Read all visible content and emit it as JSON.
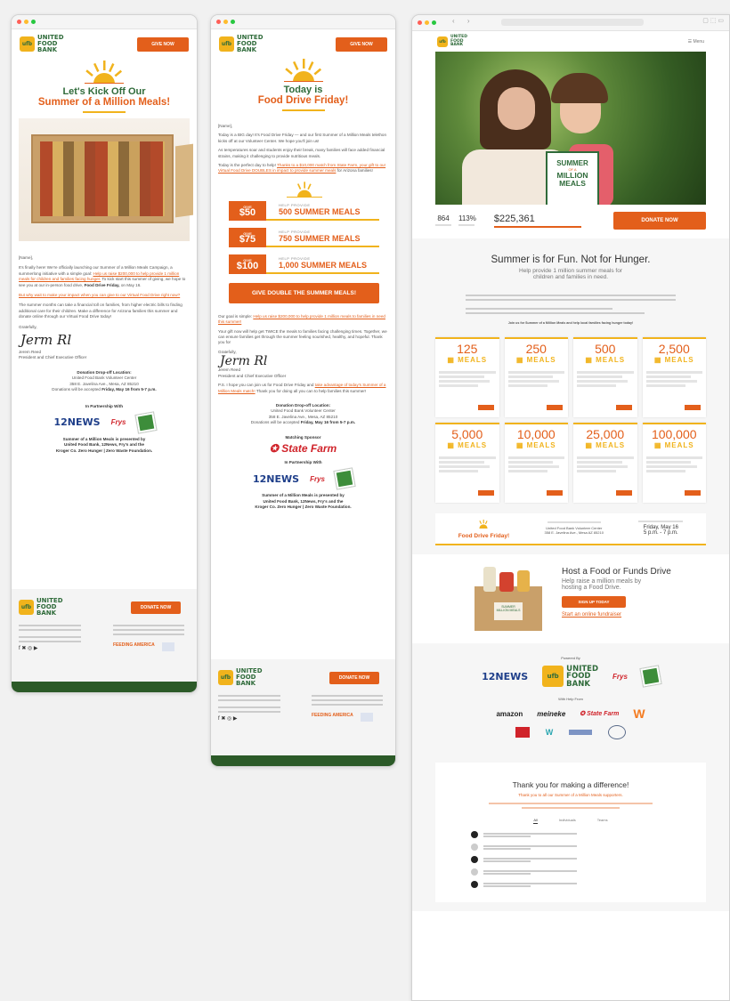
{
  "email1": {
    "logo": {
      "badge": "ufb",
      "line1": "UNITED",
      "line2": "FOOD",
      "line3": "BANK"
    },
    "give_now": "GIVE NOW",
    "headline1": "Let's Kick Off Our",
    "headline2": "Summer of a Million Meals!",
    "salutation": "[Name],",
    "para1": "It's finally here! We're officially launching our Summer of a Million Meals Campaign, a summerlong initiative with a simple goal:",
    "para1_link": "Help us raise $200,000 to help provide 1 million meals for children and families facing hunger.",
    "para1b": "To kick start this summer of giving, we hope to see you at our in-person food drive,",
    "para1_bold": "Food Drive Friday,",
    "para1c": "on May 16.",
    "para2_link": "But why wait to make your impact when you can give to our Virtual Food Drive right now?",
    "para3": "The summer months can take a financial toll on families, from higher electric bills to finding additional care for their children. Make a difference for Arizona families this summer and donate online through our Virtual Food Drive today!",
    "closing": "Gratefully,",
    "signature": "Jerm Rl",
    "signer_name": "Jerem Reed",
    "signer_title": "President and Chief Executive Officer",
    "dropoff_title": "Donation Drop-off Location:",
    "dropoff_line1": "United Food Bank Volunteer Center",
    "dropoff_line2": "358 E. Javelina Ave., Mesa, AZ 85210",
    "dropoff_line3": "Donations will be accepted",
    "dropoff_bold": "Friday, May 16 from 5-7 p.m.",
    "partnership": "In Partnership With",
    "partner_12news": "12NEWS",
    "partner_frys": "Frys",
    "presented1": "Summer of a Million Meals is presented by",
    "presented2": "United Food Bank, 12News, Fry's and the",
    "presented3": "Kroger Co. Zero Hunger | Zero Waste Foundation.",
    "donate_now": "DONATE NOW",
    "footer_america": "FEEDING AMERICA"
  },
  "email2": {
    "give_now": "GIVE NOW",
    "headline1": "Today is",
    "headline2": "Food Drive Friday!",
    "salutation": "[Name],",
    "para1": "Today is a BIG day! It's Food Drive Friday — and our first Summer of a Million Meals telethon kicks off at our Volunteer Center. We hope you'll join us!",
    "para2": "As temperatures soar and students enjoy their break, many families will face added financial strains, making it challenging to provide nutritious meals.",
    "para3": "Today is the perfect day to help!",
    "para3_link": "Thanks to a $10,000 match from State Farm, your gift to our Virtual Food Drive DOUBLES in impact to provide summer meals",
    "para3b": "for Arizona families!",
    "tiers": [
      {
        "give": "GIVE",
        "amount": "$50",
        "help": "HELP PROVIDE",
        "meals": "500 SUMMER MEALS"
      },
      {
        "give": "GIVE",
        "amount": "$75",
        "help": "HELP PROVIDE",
        "meals": "750 SUMMER MEALS"
      },
      {
        "give": "GIVE",
        "amount": "$100",
        "help": "HELP PROVIDE",
        "meals": "1,000 SUMMER MEALS"
      }
    ],
    "give_double": "GIVE DOUBLE THE SUMMER MEALS!",
    "para4": "Our goal is simple:",
    "para4_link": "Help us raise $200,000 to help provide 1 million meals to families in need this summer!",
    "para5": "Your gift now will help get TWICE the meals to families facing challenging times. Together, we can ensure families get through the summer feeling nourished, healthy, and hopeful. Thank you for",
    "closing": "Gratefully,",
    "signature": "Jerm Rl",
    "signer_name": "Jerem Reed",
    "signer_title": "President and Chief Executive Officer",
    "ps": "P.S. I hope you can join us for Food Drive Friday and",
    "ps_link": "take advantage of today's Summer of a Million Meals match!",
    "ps_b": "Thank you for doing all you can to help families this summer!",
    "dropoff_title": "Donation Drop-off Location:",
    "dropoff_line1": "United Food Bank Volunteer Center",
    "dropoff_line2": "358 E. Javelina Ave., Mesa, AZ 85210",
    "dropoff_line3": "Donations will be accepted",
    "dropoff_bold": "Friday, May 16 from 5-7 p.m.",
    "matching": "Matching Sponsor",
    "statefarm": "State Farm",
    "partnership": "In Partnership With",
    "presented1": "Summer of a Million Meals is presented by",
    "presented2": "United Food Bank, 12News, Fry's and the",
    "presented3": "Kroger Co. Zero Hunger | Zero Waste Foundation.",
    "donate_now": "DONATE NOW"
  },
  "site": {
    "menu": "Menu",
    "hero_badge1": "SUMMER",
    "hero_badge2": "OF A",
    "hero_badge3": "MILLION",
    "hero_badge4": "MEALS",
    "stat1": "864",
    "stat2": "113%",
    "raised": "$225,361",
    "donate_now": "DONATE NOW",
    "heading": "Summer is for Fun. Not for Hunger.",
    "subheading1": "Help provide 1 million summer meals for",
    "subheading2": "children and families in need.",
    "join": "Join us for Summer of a Million Meals and help local families facing hunger today!",
    "meals": [
      {
        "num": "125",
        "lbl": "MEALS"
      },
      {
        "num": "250",
        "lbl": "MEALS"
      },
      {
        "num": "500",
        "lbl": "MEALS"
      },
      {
        "num": "2,500",
        "lbl": "MEALS"
      },
      {
        "num": "5,000",
        "lbl": "MEALS"
      },
      {
        "num": "10,000",
        "lbl": "MEALS"
      },
      {
        "num": "25,000",
        "lbl": "MEALS"
      },
      {
        "num": "100,000",
        "lbl": "MEALS"
      }
    ],
    "fdf": "Food Drive Friday!",
    "fdf_loc1": "United Food Bank Volunteer Center",
    "fdf_loc2": "358 E. Javelina Ave., Mesa AZ 85210",
    "fdf_date1": "Friday, May 16",
    "fdf_date2": "5 p.m. - 7 p.m.",
    "host_title": "Host a Food or Funds Drive",
    "host_sub1": "Help raise a million meals by",
    "host_sub2": "hosting a Food Drive.",
    "host_btn": "SIGN UP TODAY",
    "host_link": "Start an online fundraiser",
    "powered": "Powered By",
    "with_help": "With Help From",
    "amazon": "amazon",
    "meineke": "meineke",
    "statefarm": "State Farm",
    "thank_title": "Thank you for making a difference!",
    "thank_sub": "Thank you to all our Summer of a Million Meals supporters.",
    "tabs": [
      "All",
      "Individuals",
      "Teams"
    ]
  }
}
